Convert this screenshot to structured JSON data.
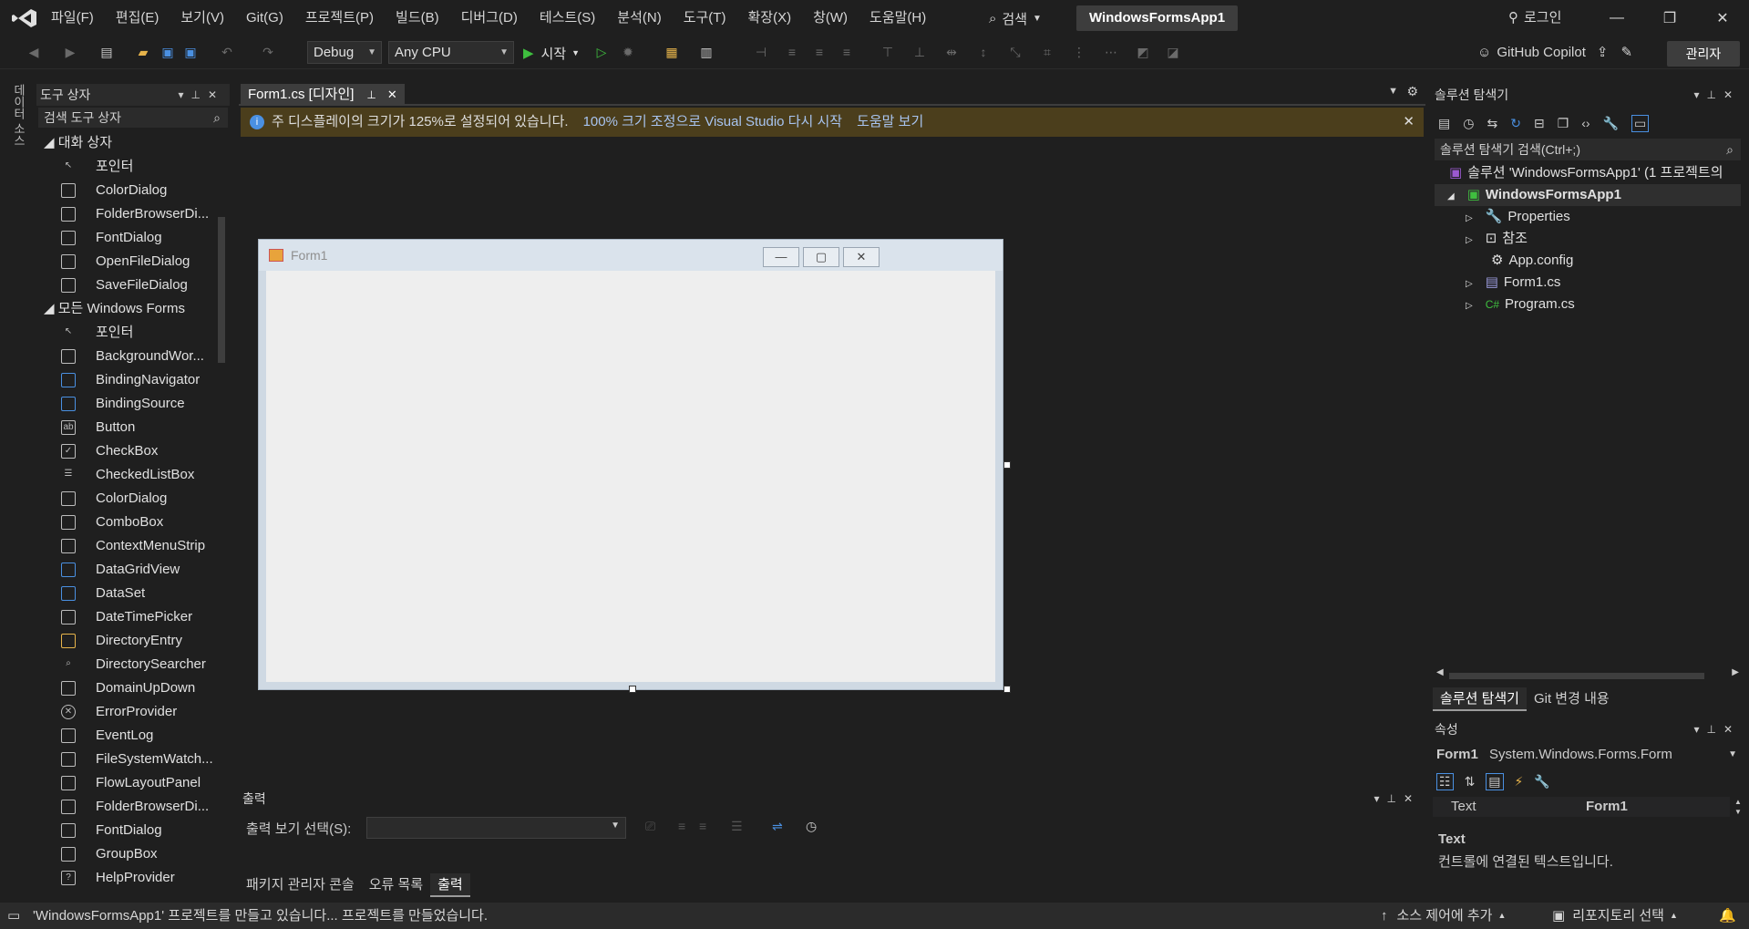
{
  "menu": [
    "파일(F)",
    "편집(E)",
    "보기(V)",
    "Git(G)",
    "프로젝트(P)",
    "빌드(B)",
    "디버그(D)",
    "테스트(S)",
    "분석(N)",
    "도구(T)",
    "확장(X)",
    "창(W)",
    "도움말(H)"
  ],
  "search_label": "검색",
  "solution_name": "WindowsFormsApp1",
  "login": "로그인",
  "toolbar": {
    "config": "Debug",
    "platform": "Any CPU",
    "start": "시작",
    "copilot": "GitHub Copilot",
    "admin": "관리자"
  },
  "side_tab": "데이터 소스",
  "toolbox": {
    "title": "도구 상자",
    "search_placeholder": "검색 도구 상자",
    "groups": [
      {
        "name": "대화 상자",
        "items": [
          "포인터",
          "ColorDialog",
          "FolderBrowserDi...",
          "FontDialog",
          "OpenFileDialog",
          "SaveFileDialog"
        ]
      },
      {
        "name": "모든 Windows Forms",
        "items": [
          "포인터",
          "BackgroundWor...",
          "BindingNavigator",
          "BindingSource",
          "Button",
          "CheckBox",
          "CheckedListBox",
          "ColorDialog",
          "ComboBox",
          "ContextMenuStrip",
          "DataGridView",
          "DataSet",
          "DateTimePicker",
          "DirectoryEntry",
          "DirectorySearcher",
          "DomainUpDown",
          "ErrorProvider",
          "EventLog",
          "FileSystemWatch...",
          "FlowLayoutPanel",
          "FolderBrowserDi...",
          "FontDialog",
          "GroupBox",
          "HelpProvider"
        ]
      }
    ]
  },
  "doc": {
    "tab_label": "Form1.cs [디자인]",
    "info_text": "주 디스플레이의 크기가 125%로 설정되어 있습니다.",
    "info_link1": "100% 크기 조정으로 Visual Studio 다시 시작",
    "info_link2": "도움말 보기"
  },
  "form": {
    "title": "Form1"
  },
  "output": {
    "title": "출력",
    "source_label": "출력 보기 선택(S):"
  },
  "bottom_tabs": [
    "패키지 관리자 콘솔",
    "오류 목록",
    "출력"
  ],
  "solution_explorer": {
    "title": "솔루션 탐색기",
    "search_placeholder": "솔루션 탐색기 검색(Ctrl+;)",
    "solution_line": "솔루션 'WindowsFormsApp1' (1 프로젝트의",
    "project": "WindowsFormsApp1",
    "items": [
      "Properties",
      "참조",
      "App.config",
      "Form1.cs",
      "Program.cs"
    ],
    "tabs": [
      "솔루션 탐색기",
      "Git 변경 내용"
    ]
  },
  "properties": {
    "title": "속성",
    "object_name": "Form1",
    "object_type": "System.Windows.Forms.Form",
    "prop_name": "Text",
    "prop_value": "Form1",
    "desc_title": "Text",
    "desc_text": "컨트롤에 연결된 텍스트입니다."
  },
  "status": {
    "message": "'WindowsFormsApp1' 프로젝트를 만들고 있습니다... 프로젝트를 만들었습니다.",
    "source_control": "소스 제어에 추가",
    "repo": "리포지토리 선택"
  },
  "colors": {
    "accent": "#9b59d0",
    "info_bar": "#4b3e1c",
    "status_bar": "#2b2b2b"
  }
}
